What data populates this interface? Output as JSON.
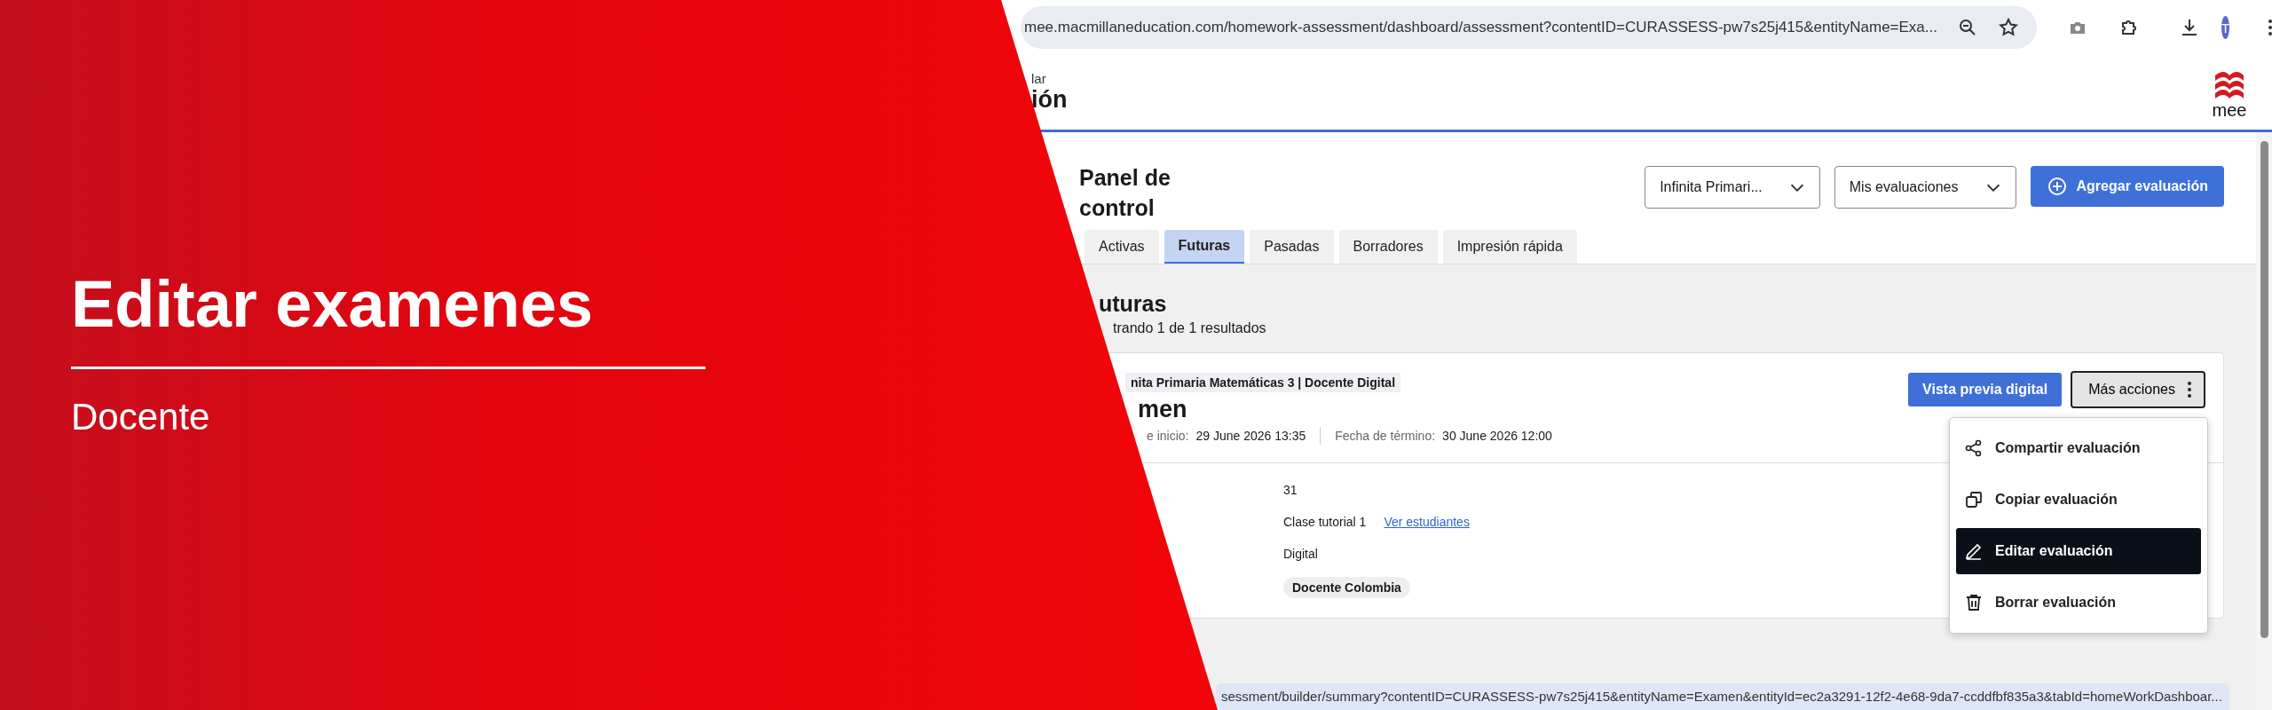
{
  "browser": {
    "url": "mee.macmillaneducation.com/homework-assessment/dashboard/assessment?contentID=CURASSESS-pw7s25j415&entityName=Exa...",
    "avatar": "T",
    "status_url": "sessment/builder/summary?contentID=CURASSESS-pw7s25j415&entityName=Examen&entityId=ec2a3291-12f2-4e68-9da7-ccddfbf835a3&tabId=homeWorkDashboar..."
  },
  "header": {
    "breadcrumb": "lar",
    "title": "ión",
    "logo_text": "mee"
  },
  "dashboard": {
    "title": "Panel de control",
    "filters": [
      {
        "value": "Infinita Primari..."
      },
      {
        "value": "Mis evaluaciones"
      }
    ],
    "add_button": "Agregar evaluación",
    "tabs": [
      {
        "label": "Activas",
        "selected": false
      },
      {
        "label": "Futuras",
        "selected": true
      },
      {
        "label": "Pasadas",
        "selected": false
      },
      {
        "label": "Borradores",
        "selected": false
      },
      {
        "label": "Impresión rápida",
        "selected": false
      }
    ]
  },
  "section": {
    "title": "uturas",
    "results": "trando 1 de 1 resultados"
  },
  "card": {
    "tag": "nita Primaria Matemáticas 3 | Docente Digital",
    "title": "men",
    "start_label": "e inicio:",
    "start": "29 June 2026 13:35",
    "end_label": "Fecha de término:",
    "end": "30 June 2026 12:00",
    "details": [
      {
        "kind": "text",
        "value": "31"
      },
      {
        "kind": "link",
        "value": "Clase tutorial 1",
        "link": "Ver estudiantes"
      },
      {
        "kind": "text",
        "value": "Digital"
      },
      {
        "kind": "chip",
        "value": "Docente Colombia"
      }
    ],
    "preview_button": "Vista previa digital",
    "more_button": "Más acciones",
    "menu": [
      {
        "kind": "share",
        "label": "Compartir evaluación",
        "selected": false
      },
      {
        "kind": "copy",
        "label": "Copiar evaluación",
        "selected": false
      },
      {
        "kind": "edit",
        "label": "Editar evaluación",
        "selected": true
      },
      {
        "kind": "delete",
        "label": "Borrar evaluación",
        "selected": false
      }
    ]
  },
  "banner": {
    "title": "Editar examenes",
    "subtitle": "Docente"
  }
}
